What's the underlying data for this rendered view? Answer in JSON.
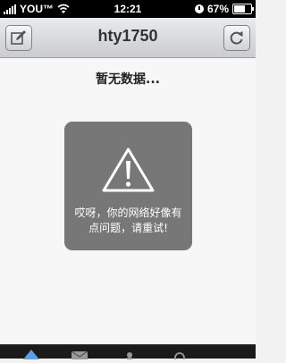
{
  "status": {
    "carrier": "YOU™",
    "time": "12:21",
    "battery_text": "67%",
    "battery_level": 0.67
  },
  "nav": {
    "title": "hty1750",
    "left_icon": "compose-icon",
    "right_icon": "refresh-icon"
  },
  "content": {
    "empty_message": "暂无数据...",
    "error_line1": "哎呀，你的网络好像有",
    "error_line2": "点问题，请重试!",
    "error_icon": "warning-icon"
  },
  "tabs": [
    {
      "icon": "home-icon"
    },
    {
      "icon": "mail-icon"
    },
    {
      "icon": "person-icon"
    },
    {
      "icon": "search-icon"
    }
  ],
  "colors": {
    "error_box": "#777777",
    "status_bar": "#000000"
  }
}
